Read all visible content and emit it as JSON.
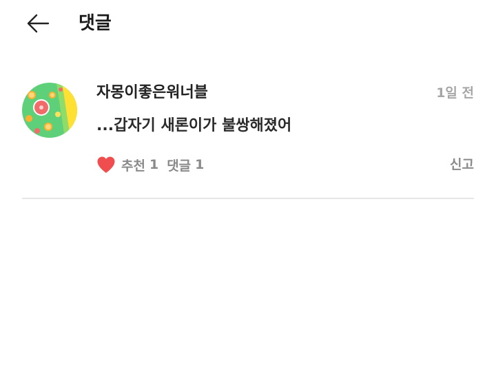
{
  "header": {
    "title": "댓글",
    "back_icon": "arrow-left-icon"
  },
  "comment": {
    "author": "자몽이좋은워너블",
    "timestamp": "1일 전",
    "body": "...갑자기 새론이가 불쌍해졌어",
    "avatar_icon": "grapefruit-avatar",
    "like_icon": "heart-icon",
    "like_label": "추천",
    "like_count": "1",
    "reply_label": "댓글",
    "reply_count": "1",
    "report_label": "신고"
  },
  "colors": {
    "heart": "#f04e4e",
    "muted_text": "#8a8a8a",
    "timestamp": "#a6a6a6",
    "avatar_green": "#5fd07a",
    "avatar_yellow": "#ffe033"
  }
}
